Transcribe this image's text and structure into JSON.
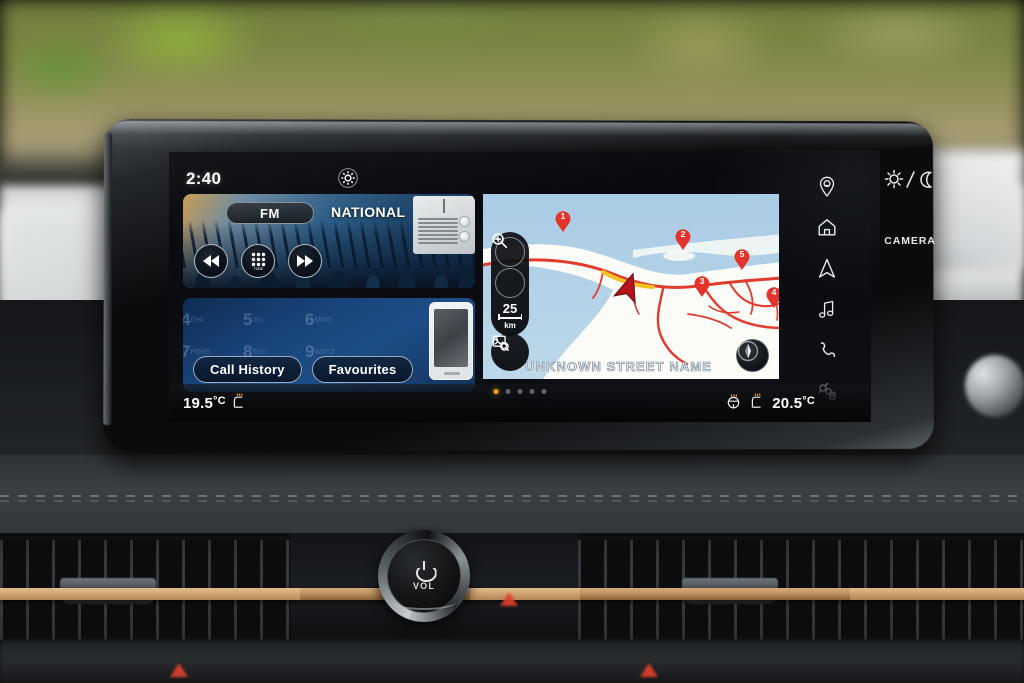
{
  "device": {
    "type": "car-infotainment-head-unit"
  },
  "screen": {
    "status": {
      "clock": "2:40"
    },
    "settings_icon": "gear-icon",
    "widgets": {
      "radio": {
        "band_label": "FM",
        "station_label": "NATIONAL",
        "controls": [
          {
            "name": "rewind-button",
            "icon": "rewind-icon"
          },
          {
            "name": "keypad-button",
            "icon": "keypad-icon"
          },
          {
            "name": "fast-forward-button",
            "icon": "fast-forward-icon"
          }
        ],
        "artwork": "crowd-concert-photo",
        "thumbnail": "radio-receiver-image"
      },
      "phone": {
        "keypad_ghost": [
          "4",
          "5",
          "6",
          "7",
          "8",
          "9"
        ],
        "keypad_ghost_sub": [
          "GHI",
          "JKL",
          "MNO",
          "PQRS",
          "TUV",
          "WXYZ"
        ],
        "buttons": [
          {
            "name": "call-history-button",
            "label": "Call History"
          },
          {
            "name": "favourites-button",
            "label": "Favourites"
          }
        ],
        "thumbnail": "smartphone-image"
      }
    },
    "map": {
      "street_name": "UNKNOWN STREET NAME",
      "zoom_in_icon": "magnifier-plus-icon",
      "zoom_out_icon": "magnifier-minus-icon",
      "scale_value": "25",
      "scale_unit": "km",
      "search_icon": "map-search-icon",
      "compass_icon": "compass-icon",
      "markers": [
        "1",
        "2",
        "3",
        "5",
        "4"
      ],
      "vehicle_marker": "navigation-arrow"
    },
    "rail": [
      {
        "name": "rail-item-location",
        "icon": "location-pin-icon"
      },
      {
        "name": "rail-item-home",
        "icon": "home-icon"
      },
      {
        "name": "rail-item-navigation",
        "icon": "navigation-arrow-icon"
      },
      {
        "name": "rail-item-media",
        "icon": "music-note-icon"
      },
      {
        "name": "rail-item-phone",
        "icon": "phone-handset-icon"
      },
      {
        "name": "rail-item-vehicle",
        "icon": "car-settings-icon"
      }
    ],
    "statusbar": {
      "left_temp": "19.5",
      "left_unit": "°C",
      "left_icon": "seat-heater-icon",
      "right_temp": "20.5",
      "right_unit": "°C",
      "right_icons": [
        "steering-wheel-heater-icon",
        "seat-heater-icon"
      ],
      "page_dots": 5,
      "active_dot": 1
    }
  },
  "bezel": {
    "brightness_icon": "sun-moon-icon",
    "camera_label": "CAMERA"
  },
  "console": {
    "volume_knob": {
      "label": "VOL",
      "icon": "power-icon"
    }
  },
  "colors": {
    "accent_orange": "#f0a020",
    "map_water": "#b2d1e7",
    "map_road": "#e23b2e",
    "map_land": "#fdfcf8",
    "widget_blue": "#1d4d86",
    "copper": "#c79a68"
  }
}
